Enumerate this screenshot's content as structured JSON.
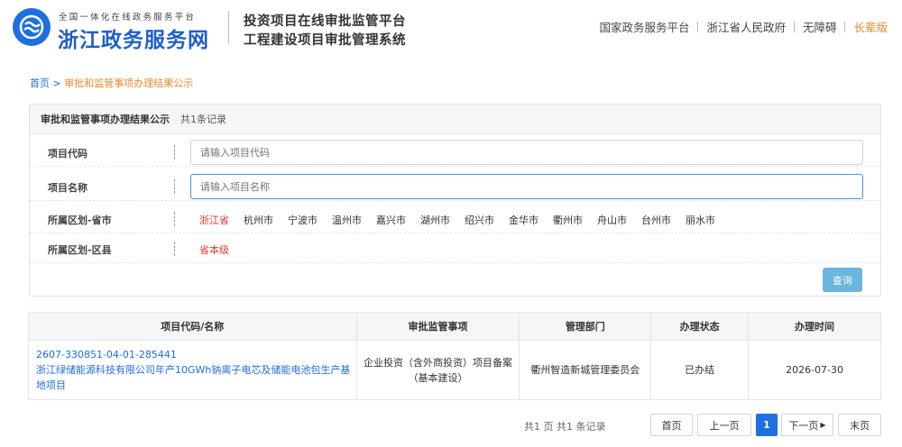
{
  "header": {
    "site_subtitle": "全国一体化在线政务服务平台",
    "site_title": "浙江政务服务网",
    "platform_line1": "投资项目在线审批监管平台",
    "platform_line2": "工程建设项目审批管理系统",
    "links": [
      "国家政务服务平台",
      "浙江省人民政府",
      "无障碍",
      "长辈版"
    ],
    "brand_color": "#1f6fe0",
    "logo_icon": "zhejiang-logo-icon"
  },
  "breadcrumb": {
    "home": "首页",
    "separator": ">",
    "current": "审批和监管事项办理结果公示"
  },
  "filter": {
    "title": "审批和监管事项办理结果公示",
    "count": "共1条记录",
    "code_label": "项目代码",
    "code_placeholder": "请输入项目代码",
    "name_label": "项目名称",
    "name_placeholder": "请输入项目名称",
    "province_label": "所属区划-省市",
    "cities": [
      "浙江省",
      "杭州市",
      "宁波市",
      "温州市",
      "嘉兴市",
      "湖州市",
      "绍兴市",
      "金华市",
      "衢州市",
      "舟山市",
      "台州市",
      "丽水市"
    ],
    "active_city": "浙江省",
    "district_label": "所属区划-区县",
    "district_value": "省本级",
    "query_button": "查询"
  },
  "table": {
    "headers": [
      "项目代码/名称",
      "审批监管事项",
      "管理部门",
      "办理状态",
      "办理时间"
    ],
    "rows": [
      {
        "code": "2607-330851-04-01-285441",
        "name": "浙江绿储能源科技有限公司年产10GWh钠离子电芯及储能电池包生产基地项目",
        "item": "企业投资（含外商投资）项目备案（基本建设）",
        "dept": "衢州智造新城管理委员会",
        "status": "已办结",
        "date": "2026-07-30"
      }
    ]
  },
  "pager": {
    "info": "共1 页 共1 条记录",
    "first": "首页",
    "prev": "上一页",
    "current": "1",
    "next": "下一页",
    "last": "末页"
  }
}
